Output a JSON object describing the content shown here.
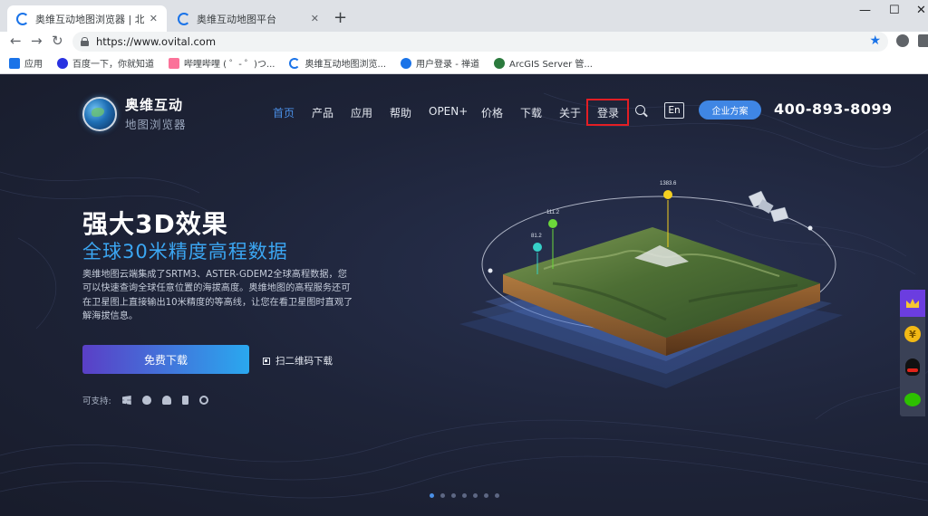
{
  "browser": {
    "tabs": [
      {
        "title": "奥维互动地图浏览器 | 北京元生华"
      },
      {
        "title": "奥维互动地图平台"
      }
    ],
    "url": "https://www.ovital.com",
    "bookmarks": [
      {
        "label": "应用",
        "icon": "apps-icon",
        "color": "#1a73e8"
      },
      {
        "label": "百度一下，你就知道",
        "icon": "baidu-paw-icon",
        "color": "#2932e1"
      },
      {
        "label": "哔哩哔哩 ( ゜- ゜)つ...",
        "icon": "bilibili-icon",
        "color": "#fb7299"
      },
      {
        "label": "奥维互动地图浏览...",
        "icon": "ovital-icon",
        "color": "#1a73e8"
      },
      {
        "label": "用户登录 - 禅道",
        "icon": "zentao-icon",
        "color": "#1a73e8"
      },
      {
        "label": "ArcGIS Server 管...",
        "icon": "arcgis-icon",
        "color": "#2b7a3d"
      }
    ]
  },
  "site": {
    "logo_name": "奥维互动",
    "logo_sub": "地图浏览器",
    "nav": [
      "首页",
      "产品",
      "应用",
      "帮助",
      "OPEN+",
      "价格",
      "下载",
      "关于",
      "登录"
    ],
    "lang": "En",
    "enterprise": "企业方案",
    "phone": "400-893-8099"
  },
  "hero": {
    "title": "强大3D效果",
    "subtitle": "全球30米精度高程数据",
    "desc": "奥维地图云端集成了SRTM3、ASTER-GDEM2全球高程数据，您可以快速查询全球任意位置的海拔高度。奥维地图的高程服务还可在卫星图上直接输出10米精度的等高线，让您在看卫星图时直观了解海拔信息。",
    "download": "免费下载",
    "qr_download": "扫二维码下载",
    "support_label": "可支持:",
    "platforms": [
      "windows-icon",
      "apple-icon",
      "android-icon",
      "mobile-icon",
      "ie-icon"
    ],
    "markers": [
      {
        "label": "81.2",
        "color": "#36d0c7"
      },
      {
        "label": "111.2",
        "color": "#6cd83a"
      },
      {
        "label": "1383.6",
        "color": "#f5d020"
      }
    ],
    "slides": 7,
    "active_slide": 0
  }
}
